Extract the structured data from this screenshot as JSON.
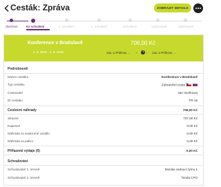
{
  "header": {
    "title": "Cesták: Zpráva",
    "details_button": "ZOBRAZIT DETAILS"
  },
  "stepper": {
    "steps": [
      {
        "label": "Otevřené",
        "state": "done"
      },
      {
        "label": "Ke schválení",
        "state": "current"
      },
      {
        "label": "1. schválení",
        "state": "todo"
      },
      {
        "label": "2. schválení",
        "state": "todo"
      },
      {
        "label": "Schválené",
        "state": "todo"
      },
      {
        "label": "Vyúčtované",
        "state": "todo"
      },
      {
        "label": "Zaúčtované",
        "state": "todo"
      }
    ]
  },
  "banner": {
    "trip_name": "Konference v Bratislavě",
    "dates": "3. 9. 2020 - 4. 9. 2020",
    "amount": "708,00 Kč",
    "from": "13a. U Průhonu ...",
    "to": "13a. U Průhonu ..."
  },
  "details": {
    "heading": "Podrobnosti",
    "rows": [
      {
        "label": "Název cestáku",
        "value": "Konference v Bratislavě"
      },
      {
        "label": "Typ cestáku",
        "value": "Zahraniční cesta"
      },
      {
        "label": "Cestovatel",
        "value": "Jan Vozthovej"
      },
      {
        "label": "ID cestáku",
        "value": "TR-15"
      }
    ]
  },
  "compensation": {
    "heading": "Cestovní náhrady",
    "total": "708,00 Kč",
    "rows": [
      {
        "label": "Stravné",
        "value": "707,60 Kč"
      },
      {
        "label": "Kapesné",
        "value": "0,00 Kč"
      },
      {
        "label": "Náhrada za soukromé vozidlo",
        "value": "0,00 Kč"
      },
      {
        "label": "Náhrada za palivo",
        "value": "0,00 Kč"
      }
    ]
  },
  "expenses": {
    "heading": "Přiřazené výdaje (0)",
    "total": "0,00 Kč"
  },
  "approvals": {
    "heading": "Schvalování",
    "rows": [
      {
        "label": "Schvalovatel 1. úrovně",
        "value": "Monika vedoucí týmu 1"
      },
      {
        "label": "Schvalovatel 2. úrovně",
        "value": "Tonda CFO"
      }
    ]
  },
  "colors": {
    "accent": "#c6d92c",
    "primary": "#6a2e7a"
  },
  "icons": {
    "back": "chevron-left-icon",
    "more": "more-dots-icon",
    "flag_from": "czech-flag-icon",
    "flag_to": "slovak-flag-icon",
    "clock": "clock-icon"
  }
}
